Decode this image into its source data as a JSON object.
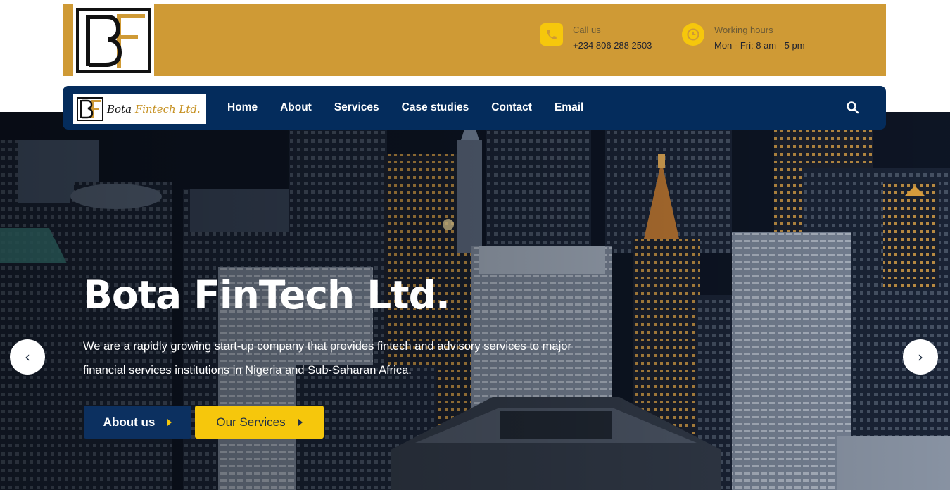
{
  "header": {
    "call": {
      "label": "Call us",
      "value": "+234 806 288 2503"
    },
    "hours": {
      "label": "Working hours",
      "value": "Mon - Fri: 8 am - 5 pm"
    }
  },
  "nav": {
    "logo_text_main": "Bota",
    "logo_text_accent": "Fintech Ltd.",
    "items": [
      {
        "label": "Home"
      },
      {
        "label": "About"
      },
      {
        "label": "Services"
      },
      {
        "label": "Case studies"
      },
      {
        "label": "Contact"
      },
      {
        "label": "Email"
      }
    ],
    "search_icon": "search-icon"
  },
  "hero": {
    "title": "Bota FinTech Ltd.",
    "text": "We are a rapidly growing start-up company that provides fintech and advisory services to major financial services institutions in Nigeria and Sub-Saharan Africa.",
    "buttons": {
      "about": "About us",
      "services": "Our Services"
    },
    "prev_icon": "chevron-left-icon",
    "next_icon": "chevron-right-icon",
    "prev_glyph": "‹",
    "next_glyph": "›"
  },
  "colors": {
    "topbar": "#cf9a35",
    "navbar": "#042c5c",
    "accent_yellow": "#f6c70c",
    "button_navy": "#0c3060"
  }
}
